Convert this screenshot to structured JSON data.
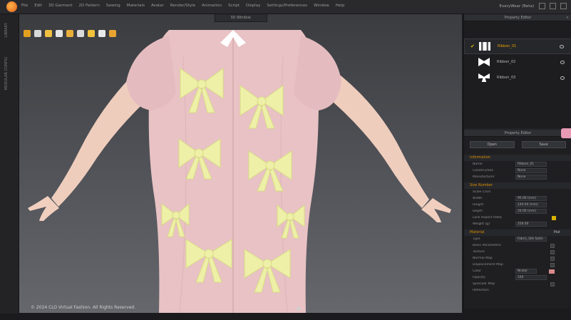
{
  "app": {
    "title": "EveryWear (Beta)",
    "menu": [
      "File",
      "Edit",
      "3D Garment",
      "2D Pattern",
      "Sewing",
      "Materials",
      "Avatar",
      "Render/Style",
      "Animation",
      "Script",
      "Display",
      "Settings/Preferences",
      "Window",
      "Help"
    ]
  },
  "left_strip": {
    "tabs": [
      "LIBRARY",
      "MODULAR CONFIG"
    ]
  },
  "viewport": {
    "tab_label": "3D Window",
    "copyright": "© 2024 CLO Virtual Fashion. All Rights Reserved.",
    "colors": {
      "dress": "#e9c4c6",
      "bows": "#eef0a8",
      "skin": "#f2cfc0"
    },
    "toolbar_icons": [
      "cursor-icon",
      "select-icon",
      "fold-icon",
      "tack-icon",
      "pin-icon",
      "measure-icon",
      "steam-icon",
      "avatar-icon",
      "sun-icon"
    ]
  },
  "object_browser": {
    "title": "Property Editor",
    "fabrics": [
      {
        "name": "Ribbon_01",
        "selected": true,
        "swatch": "#f2f2f2"
      },
      {
        "name": "Ribbon_02",
        "selected": false,
        "swatch": "#ffffff"
      },
      {
        "name": "Ribbon_03",
        "selected": false,
        "swatch": "#ffffff"
      }
    ]
  },
  "property_editor": {
    "title": "Property Editor",
    "buttons": {
      "open": "Open",
      "save": "Save"
    },
    "sections": {
      "information": "Information",
      "size_number": "Size Number",
      "material": "Material"
    },
    "rows": {
      "name": {
        "label": "Name",
        "value": "Ribbon_01"
      },
      "construction": {
        "label": "Construction",
        "value": "None"
      },
      "manufacturer": {
        "label": "Manufacturer",
        "value": "None"
      },
      "scale_cm": {
        "label": "Scale Cm/s"
      },
      "width": {
        "label": "Width",
        "value": "95.00 (mm)"
      },
      "height": {
        "label": "Height",
        "value": "140.00 (mm)"
      },
      "depth": {
        "label": "Depth",
        "value": "20.00 (mm)"
      },
      "lock_ratio": {
        "label": "Lock Aspect Ratio"
      },
      "weight": {
        "label": "Weight (g)",
        "value": "256.00"
      },
      "type": {
        "label": "Type",
        "value": "Fabric_Silk Satin"
      },
      "basic_params": {
        "label": "Basic Parameters"
      },
      "texture": {
        "label": "Texture"
      },
      "normal_map": {
        "label": "Normal Map"
      },
      "displacement": {
        "label": "Displacement Map"
      },
      "color": {
        "label": "Color",
        "value": "Ncolor"
      },
      "opacity": {
        "label": "Opacity",
        "value": "100"
      },
      "specular_map": {
        "label": "Specular Map"
      },
      "reflection": {
        "label": "Reflection"
      }
    },
    "material_mode": "Mat"
  }
}
